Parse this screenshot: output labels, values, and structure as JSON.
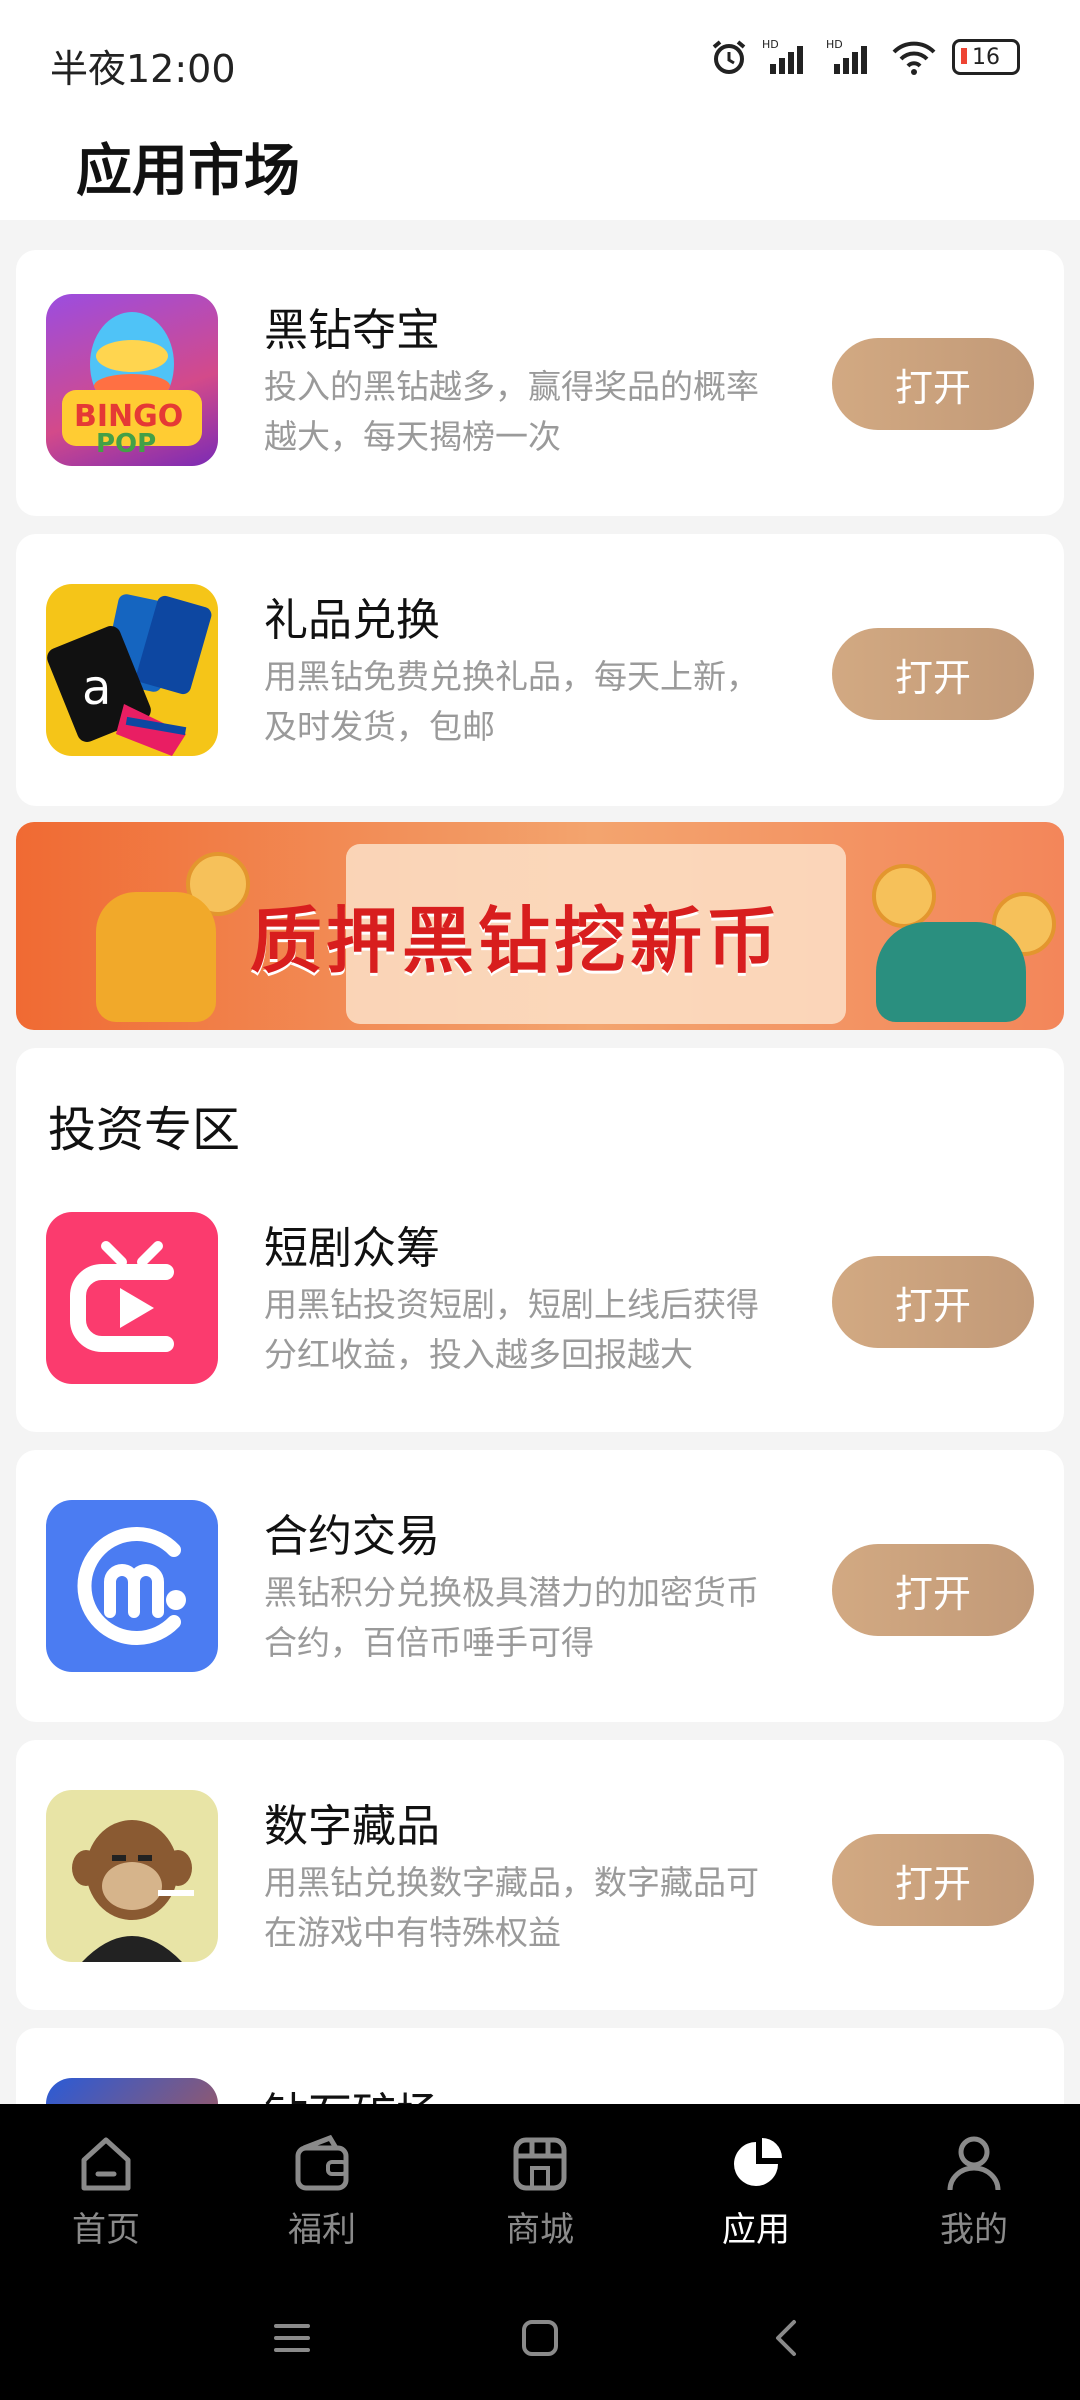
{
  "status": {
    "time": "半夜12:00",
    "battery": "16"
  },
  "header": {
    "title": "应用市场"
  },
  "apps_top": [
    {
      "title": "黑钻夺宝",
      "desc": "投入的黑钻越多，赢得奖品的概率越大，每天揭榜一次",
      "button": "打开",
      "icon": "bingo-pop-icon"
    },
    {
      "title": "礼品兑换",
      "desc": "用黑钻免费兑换礼品，每天上新，及时发货，包邮",
      "button": "打开",
      "icon": "gift-cards-icon"
    }
  ],
  "banner": {
    "text": "质押黑钻挖新币"
  },
  "invest": {
    "title": "投资专区",
    "apps": [
      {
        "title": "短剧众筹",
        "desc": "用黑钻投资短剧，短剧上线后获得分红收益，投入越多回报越大",
        "button": "打开",
        "icon": "tv-play-icon"
      },
      {
        "title": "合约交易",
        "desc": "黑钻积分兑换极具潜力的加密货币合约，百倍币唾手可得",
        "button": "打开",
        "icon": "m-coin-icon"
      },
      {
        "title": "数字藏品",
        "desc": "用黑钻兑换数字藏品，数字藏品可在游戏中有特殊权益",
        "button": "打开",
        "icon": "ape-nft-icon"
      },
      {
        "title": "钻石矿场",
        "icon": "mine-icon"
      }
    ]
  },
  "nav": [
    {
      "label": "首页",
      "icon": "home-icon"
    },
    {
      "label": "福利",
      "icon": "wallet-icon"
    },
    {
      "label": "商城",
      "icon": "shop-icon"
    },
    {
      "label": "应用",
      "icon": "apps-pie-icon"
    },
    {
      "label": "我的",
      "icon": "user-icon"
    }
  ],
  "colors": {
    "button": "#c9a07d",
    "nav_bg": "#000000",
    "nav_active": "#ffffff",
    "nav_inactive": "#8a8a8a"
  }
}
